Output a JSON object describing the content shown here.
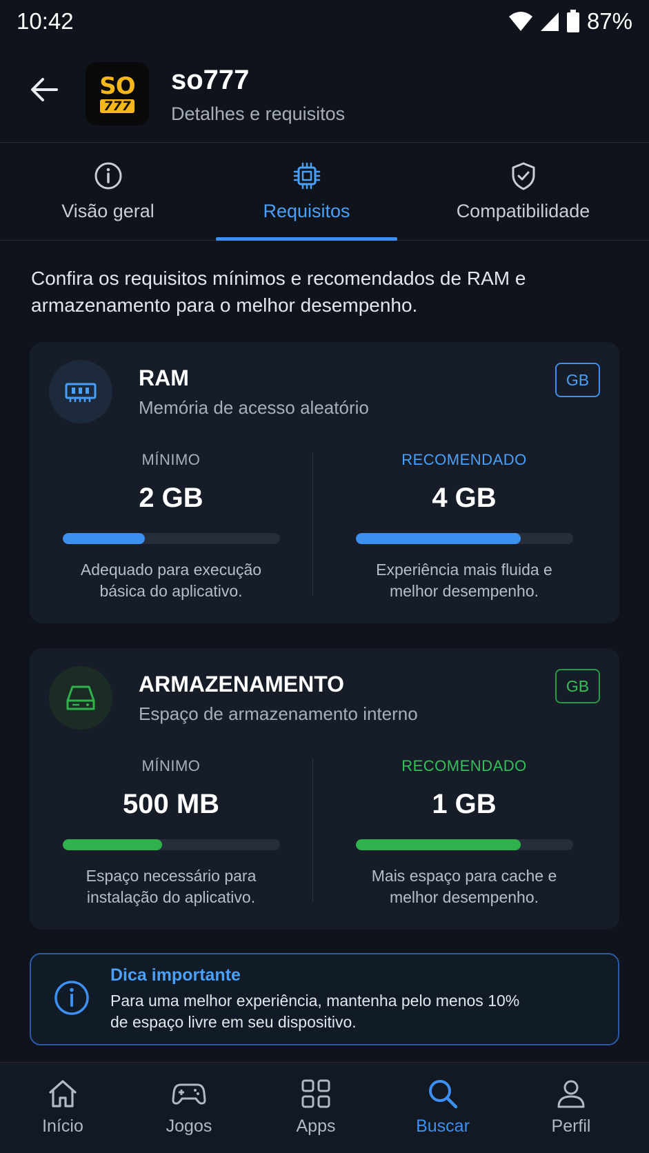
{
  "status": {
    "time": "10:42",
    "battery": "87%"
  },
  "header": {
    "logo_top": "SO",
    "logo_bottom": "777",
    "title": "so777",
    "subtitle": "Detalhes e requisitos"
  },
  "tabs": [
    {
      "label": "Visão geral",
      "icon": "info-icon",
      "active": false
    },
    {
      "label": "Requisitos",
      "icon": "chip-icon",
      "active": true
    },
    {
      "label": "Compatibilidade",
      "icon": "shield-check-icon",
      "active": false
    }
  ],
  "intro": "Confira os requisitos mínimos e recomendados de RAM e armazenamento para o melhor desempenho.",
  "cards": {
    "ram": {
      "title": "RAM",
      "subtitle": "Memória de acesso aleatório",
      "unit": "GB",
      "accent": "#3d8ff0",
      "min_label": "MÍNIMO",
      "min_value": "2 GB",
      "min_fill": 0.38,
      "min_desc_1": "Adequado para execução",
      "min_desc_2": "básica do aplicativo.",
      "rec_label": "RECOMENDADO",
      "rec_value": "4 GB",
      "rec_fill": 0.76,
      "rec_desc_1": "Experiência mais fluida e",
      "rec_desc_2": "melhor desempenho."
    },
    "storage": {
      "title": "ARMAZENAMENTO",
      "subtitle": "Espaço de armazenamento interno",
      "unit": "GB",
      "accent": "#2fb24c",
      "min_label": "MÍNIMO",
      "min_value": "500 MB",
      "min_fill": 0.46,
      "min_desc_1": "Espaço necessário para",
      "min_desc_2": "instalação do aplicativo.",
      "rec_label": "RECOMENDADO",
      "rec_value": "1 GB",
      "rec_fill": 0.76,
      "rec_desc_1": "Mais espaço para cache e",
      "rec_desc_2": "melhor desempenho."
    }
  },
  "tip": {
    "title": "Dica importante",
    "text_1": "Para uma melhor experiência, mantenha pelo menos 10%",
    "text_2": "de espaço livre em seu dispositivo."
  },
  "nav": [
    {
      "label": "Início",
      "icon": "home-icon",
      "active": false
    },
    {
      "label": "Jogos",
      "icon": "gamepad-icon",
      "active": false
    },
    {
      "label": "Apps",
      "icon": "apps-grid-icon",
      "active": false
    },
    {
      "label": "Buscar",
      "icon": "search-icon",
      "active": true
    },
    {
      "label": "Perfil",
      "icon": "person-icon",
      "active": false
    }
  ]
}
